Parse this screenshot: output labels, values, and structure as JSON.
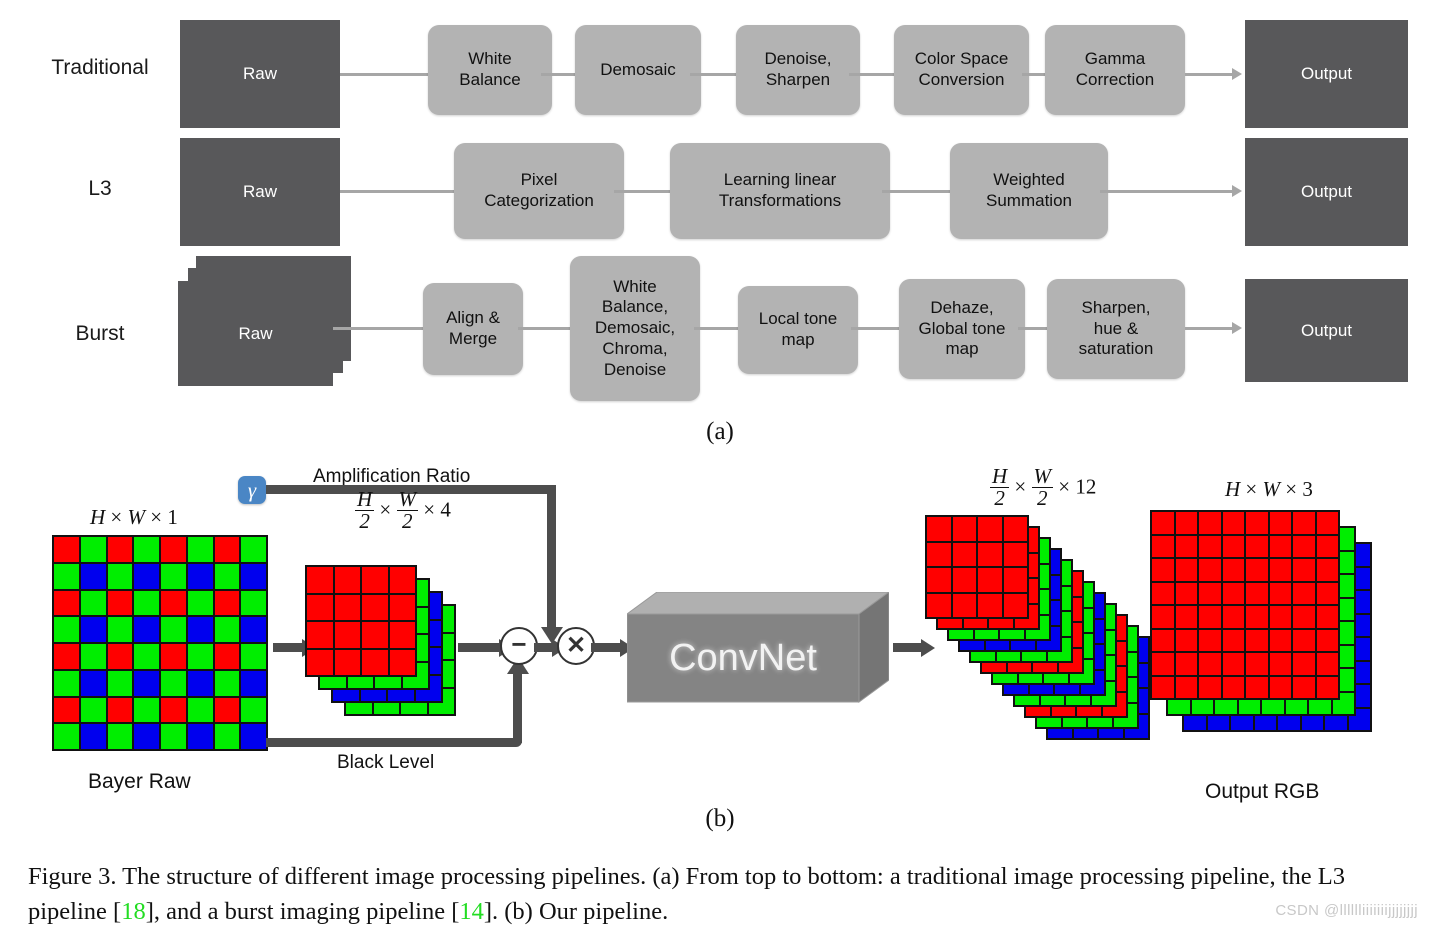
{
  "figure": {
    "panel_a_label": "(a)",
    "panel_b_label": "(b)",
    "caption_part1": "Figure 3. The structure of different image processing pipelines.  (a) From top to bottom: a traditional image processing pipeline, the L3 pipeline [",
    "caption_ref1": "18",
    "caption_part2": "], and a burst imaging pipeline [",
    "caption_ref2": "14",
    "caption_part3": "]. (b) Our pipeline.",
    "watermark": "CSDN @lllllliiiiiiijjjjjjjj"
  },
  "colors": {
    "dark_box": "#58585a",
    "stage_gray": "#b3b3b3",
    "connector": "#a6a6a6",
    "arrow_dark": "#4d4d4d",
    "red": "#ff0000",
    "green": "#00ee00",
    "blue": "#0000ee",
    "gamma_blue": "#4a86c5",
    "ref_green": "#22dd22"
  },
  "panel_a": {
    "rows": [
      {
        "label": "Traditional",
        "input": "Raw",
        "output": "Output",
        "stacked_input": false,
        "stages": [
          {
            "lines": [
              "White",
              "Balance"
            ]
          },
          {
            "lines": [
              "Demosaic"
            ]
          },
          {
            "lines": [
              "Denoise,",
              "Sharpen"
            ]
          },
          {
            "lines": [
              "Color Space",
              "Conversion"
            ]
          },
          {
            "lines": [
              "Gamma",
              "Correction"
            ]
          }
        ]
      },
      {
        "label": "L3",
        "input": "Raw",
        "output": "Output",
        "stacked_input": false,
        "stages": [
          {
            "lines": [
              "Pixel",
              "Categorization"
            ]
          },
          {
            "lines": [
              "Learning linear",
              "Transformations"
            ]
          },
          {
            "lines": [
              "Weighted",
              "Summation"
            ]
          }
        ]
      },
      {
        "label": "Burst",
        "input": "Raw",
        "output": "Output",
        "stacked_input": true,
        "stages": [
          {
            "lines": [
              "Align &",
              "Merge"
            ]
          },
          {
            "lines": [
              "White",
              "Balance,",
              "Demosaic,",
              "Chroma,",
              "Denoise"
            ]
          },
          {
            "lines": [
              "Local tone",
              "map"
            ]
          },
          {
            "lines": [
              "Dehaze,",
              "Global tone",
              "map"
            ]
          },
          {
            "lines": [
              "Sharpen,",
              "hue &",
              "saturation"
            ]
          }
        ]
      }
    ]
  },
  "panel_b": {
    "gamma_symbol": "γ",
    "amplification_label": "Amplification Ratio",
    "black_level_label": "Black Level",
    "bayer_title": "Bayer Raw",
    "bayer_dims": {
      "a": "H",
      "b": "W",
      "c": "1"
    },
    "packed_dims": {
      "num1": "H",
      "den1": "2",
      "num2": "W",
      "den2": "2",
      "c": "4"
    },
    "convnet_label": "ConvNet",
    "conv_out_dims": {
      "num1": "H",
      "den1": "2",
      "num2": "W",
      "den2": "2",
      "c": "12"
    },
    "output_dims": {
      "a": "H",
      "b": "W",
      "c": "3"
    },
    "output_title": "Output RGB",
    "minus_op": "−",
    "times_op": "✕",
    "bayer_grid_size": 8,
    "packed_plane_size": 4,
    "packed_channels": [
      "green",
      "blue",
      "green",
      "red"
    ],
    "conv_out_channels": [
      "blue",
      "green",
      "red",
      "green",
      "blue",
      "green",
      "red",
      "green",
      "blue",
      "green",
      "red",
      "red"
    ],
    "output_layers": [
      "blue",
      "green",
      "red"
    ],
    "output_grid_size": 8
  }
}
